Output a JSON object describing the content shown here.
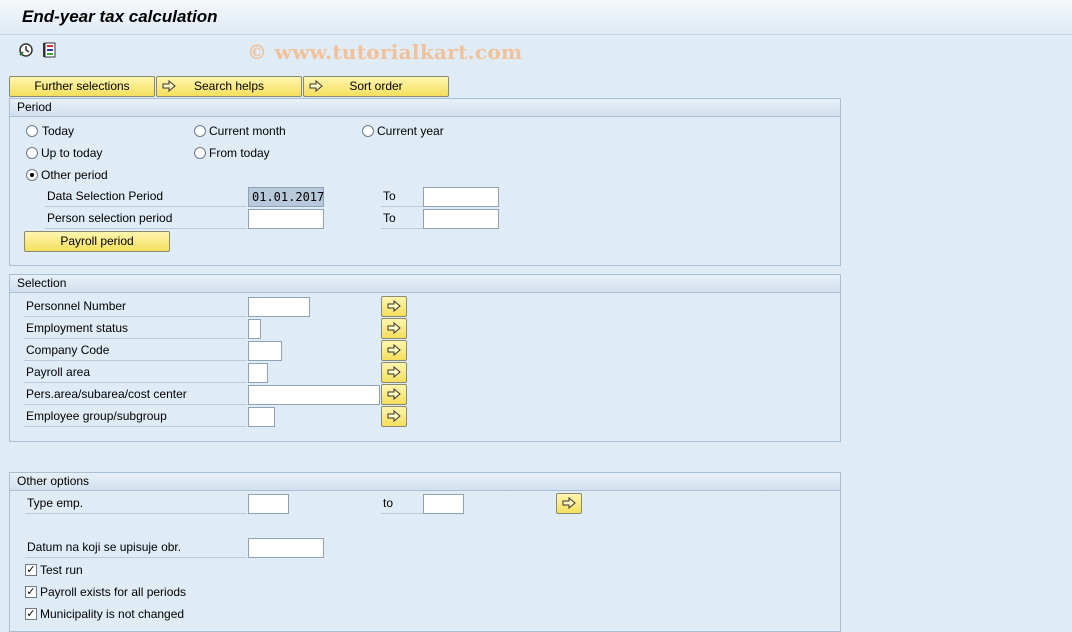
{
  "window": {
    "title": "End-year tax calculation"
  },
  "watermark": "© www.tutorialkart.com",
  "toolbar": {
    "icons": [
      "execute-icon",
      "get-variant-icon"
    ]
  },
  "header_buttons": {
    "further_selections": "Further selections",
    "search_helps": "Search helps",
    "sort_order": "Sort order"
  },
  "period": {
    "title": "Period",
    "today": "Today",
    "current_month": "Current month",
    "current_year": "Current year",
    "up_to_today": "Up to today",
    "from_today": "From today",
    "other_period": "Other period",
    "selected": "other_period",
    "data_selection_label": "Data Selection Period",
    "data_selection_from": "01.01.2017",
    "data_selection_to": "",
    "person_selection_label": "Person selection period",
    "person_selection_from": "",
    "person_selection_to": "",
    "to_label": "To",
    "payroll_period_button": "Payroll period"
  },
  "selection": {
    "title": "Selection",
    "fields": [
      {
        "label": "Personnel Number",
        "value": ""
      },
      {
        "label": "Employment status",
        "value": ""
      },
      {
        "label": "Company Code",
        "value": ""
      },
      {
        "label": "Payroll area",
        "value": ""
      },
      {
        "label": "Pers.area/subarea/cost center",
        "value": ""
      },
      {
        "label": "Employee group/subgroup",
        "value": ""
      }
    ]
  },
  "other_options": {
    "title": "Other options",
    "type_emp_label": "Type emp.",
    "type_emp_from": "",
    "type_emp_to_label": "to",
    "type_emp_to": "",
    "datum_label": "Datum na koji se upisuje obr.",
    "datum_value": "",
    "test_run": "Test run",
    "payroll_exists": "Payroll exists for all periods",
    "municipality": "Municipality is not changed"
  },
  "colors": {
    "background": "#dfebf5",
    "button_yellow": "#f4df5c",
    "watermark": "#f1c29a"
  }
}
